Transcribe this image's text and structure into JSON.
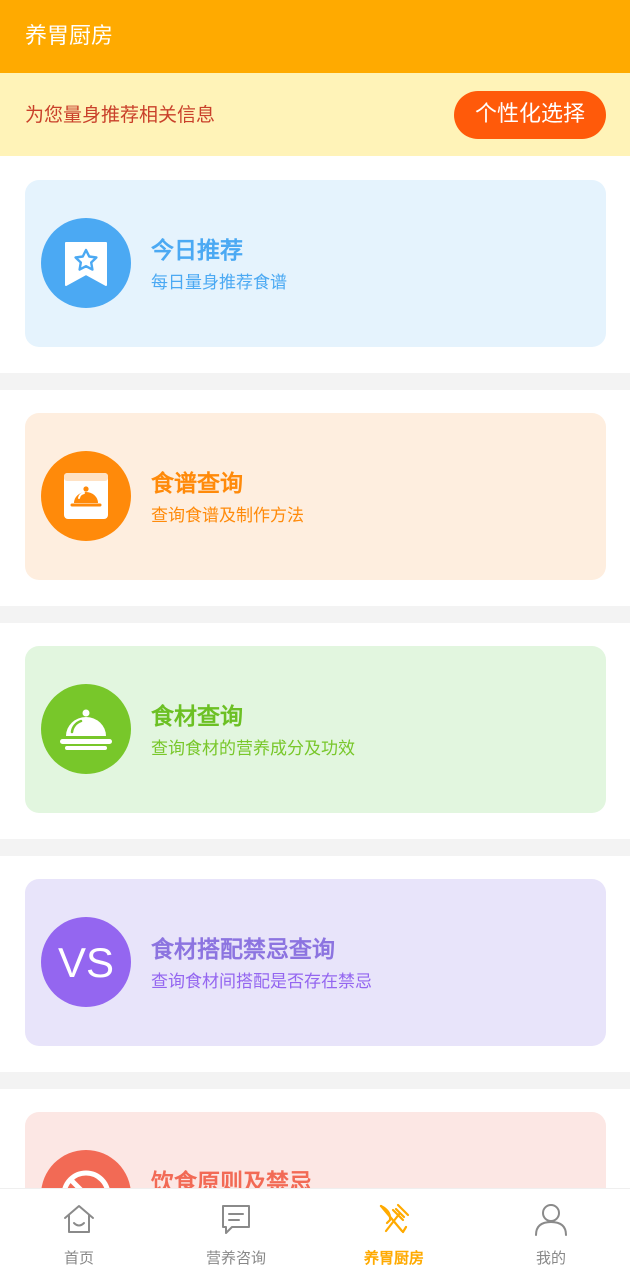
{
  "header": {
    "title": "养胃厨房"
  },
  "banner": {
    "message": "为您量身推荐相关信息",
    "button_label": "个性化选择"
  },
  "cards": [
    {
      "title": "今日推荐",
      "subtitle": "每日量身推荐食谱",
      "icon": "bookmark-star-icon",
      "bg": "#E5F3FD",
      "accent": "#4BA9F3",
      "title_color": "#4BA9F3"
    },
    {
      "title": "食谱查询",
      "subtitle": "查询食谱及制作方法",
      "icon": "recipe-book-icon",
      "bg": "#FEEEDF",
      "accent": "#FF8A0A",
      "title_color": "#FF8A0A"
    },
    {
      "title": "食材查询",
      "subtitle": "查询食材的营养成分及功效",
      "icon": "cloche-icon",
      "bg": "#E2F6DF",
      "accent": "#78C72A",
      "title_color": "#6CC024"
    },
    {
      "title": "食材搭配禁忌查询",
      "subtitle": "查询食材间搭配是否存在禁忌",
      "icon": "vs-icon",
      "icon_text": "VS",
      "bg": "#E8E4FA",
      "accent": "#9466F0",
      "title_color": "#8C74E0"
    },
    {
      "title": "饮食原则及禁忌",
      "subtitle": "",
      "icon": "forbidden-icon",
      "bg": "#FCE7E4",
      "accent": "#F26A55",
      "title_color": "#F26A55"
    }
  ],
  "tabbar": {
    "items": [
      {
        "label": "首页",
        "icon": "home-icon",
        "active": false
      },
      {
        "label": "营养咨询",
        "icon": "chat-icon",
        "active": false
      },
      {
        "label": "养胃厨房",
        "icon": "utensils-icon",
        "active": true
      },
      {
        "label": "我的",
        "icon": "user-icon",
        "active": false
      }
    ]
  }
}
